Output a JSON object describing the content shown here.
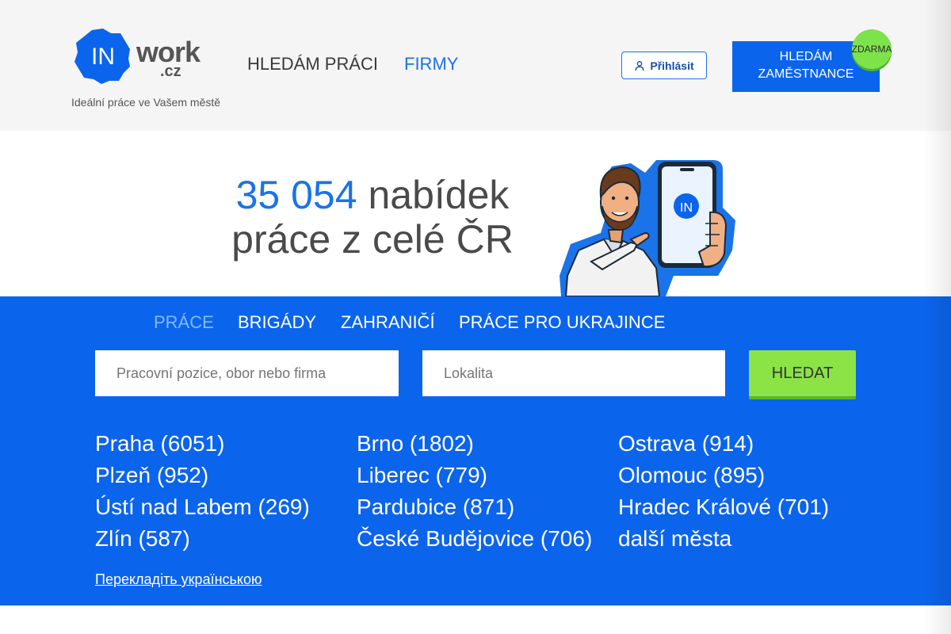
{
  "header": {
    "logo_badge": "IN",
    "logo_word": "work",
    "logo_tld": ".cz",
    "tagline": "Ideální práce ve Vašem městě",
    "nav": [
      {
        "label": "HLEDÁM PRÁCI"
      },
      {
        "label": "FIRMY"
      }
    ],
    "login_label": "Přihlásit",
    "employer_button": {
      "line1": "HLEDÁM",
      "line2": "ZAMĚSTNANCE"
    },
    "free_badge": "ZDARMA"
  },
  "hero": {
    "count": "35 054",
    "title_rest": "nabídek",
    "title_line2": "práce z celé ČR",
    "mascot_phone_badge": "IN"
  },
  "tabs": [
    {
      "label": "PRÁCE",
      "active": true
    },
    {
      "label": "BRIGÁDY",
      "active": false
    },
    {
      "label": "ZAHRANIČÍ",
      "active": false
    },
    {
      "label": "PRÁCE PRO UKRAJINCE",
      "active": false
    }
  ],
  "search": {
    "position_placeholder": "Pracovní pozice, obor nebo firma",
    "location_placeholder": "Lokalita",
    "button_label": "HLEDAT"
  },
  "cities": [
    [
      "Praha (6051)",
      "Brno (1802)",
      "Ostrava (914)"
    ],
    [
      "Plzeň (952)",
      "Liberec (779)",
      "Olomouc (895)"
    ],
    [
      "Ústí nad Labem (269)",
      "Pardubice (871)",
      "Hradec Králové (701)"
    ],
    [
      "Zlín (587)",
      "České Budějovice (706)",
      "další města"
    ]
  ],
  "translate_link": "Перекладіть українською",
  "colors": {
    "brand_blue": "#0b64ec",
    "link_blue": "#1a73e8",
    "active_tab": "#7fbcff",
    "accent_green": "#8be346",
    "header_bg": "#f5f5f5"
  }
}
